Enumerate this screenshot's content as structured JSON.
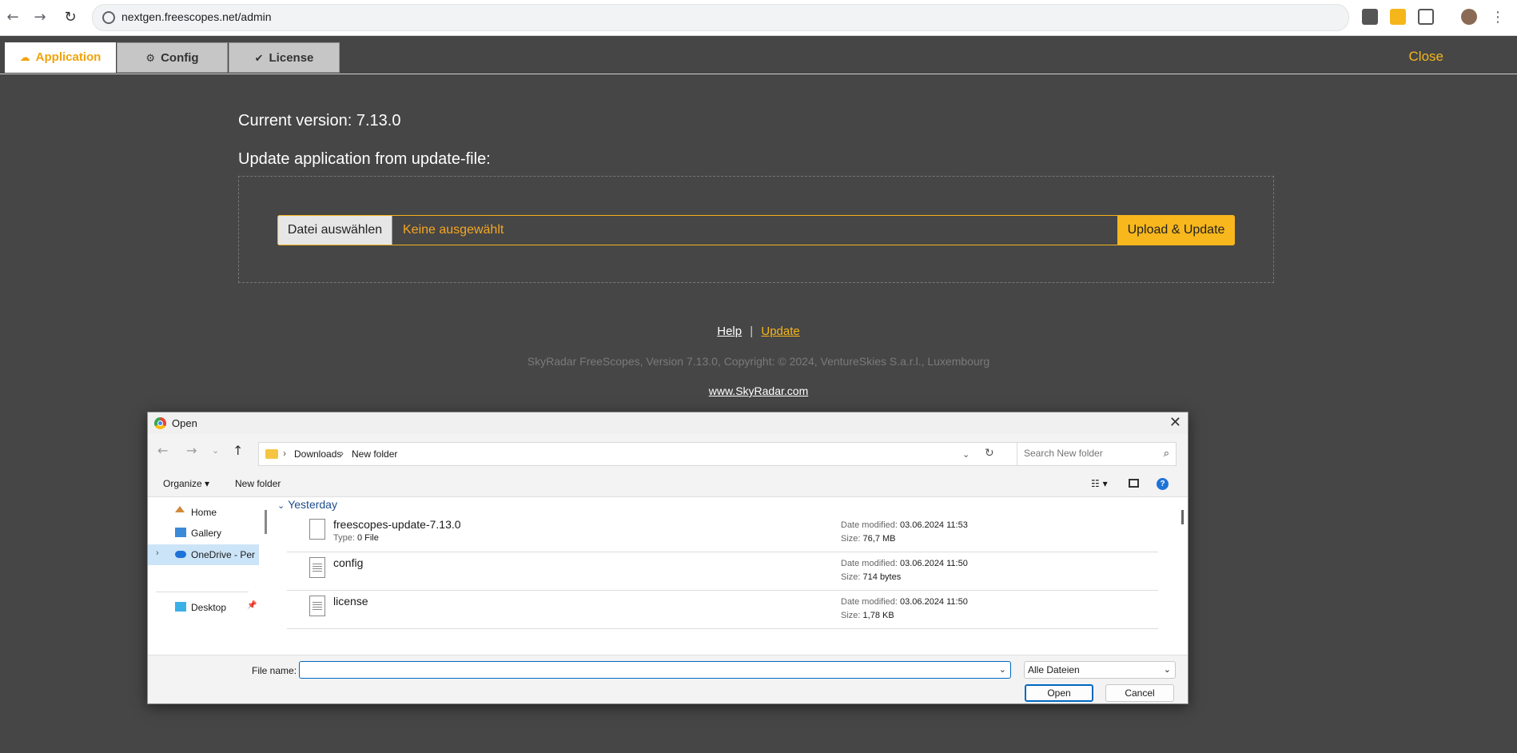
{
  "browser": {
    "url": "nextgen.freescopes.net/admin"
  },
  "tabs": [
    {
      "label": "Application",
      "icon": "cloud-upload-icon"
    },
    {
      "label": "Config",
      "icon": "gear-icon"
    },
    {
      "label": "License",
      "icon": "check-circle-icon"
    }
  ],
  "close_label": "Close",
  "main": {
    "current_version": "Current version: 7.13.0",
    "update_heading": "Update application from update-file:",
    "choose_file_label": "Datei auswählen",
    "no_file_text": "Keine ausgewählt",
    "upload_label": "Upload & Update"
  },
  "footer": {
    "help": "Help",
    "separator": "|",
    "update": "Update",
    "copyright": "SkyRadar FreeScopes, Version 7.13.0, Copyright: © 2024, VentureSkies S.a.r.l., Luxembourg",
    "website": "www.SkyRadar.com"
  },
  "dialog": {
    "title": "Open",
    "breadcrumb": [
      "Downloads",
      "New folder"
    ],
    "search_placeholder": "Search New folder",
    "organize": "Organize",
    "new_folder": "New folder",
    "nav": [
      {
        "label": "Home",
        "icon": "home-icon"
      },
      {
        "label": "Gallery",
        "icon": "gallery-icon"
      },
      {
        "label": "OneDrive - Perso",
        "icon": "onedrive-icon",
        "selected": true
      },
      {
        "label": "Desktop",
        "icon": "desktop-icon",
        "pinned": true
      }
    ],
    "group": "Yesterday",
    "files": [
      {
        "name": "freescopes-update-7.13.0",
        "type_label": "Type:",
        "type": "0 File",
        "date_label": "Date modified:",
        "date": "03.06.2024 11:53",
        "size_label": "Size:",
        "size": "76,7 MB"
      },
      {
        "name": "config",
        "date_label": "Date modified:",
        "date": "03.06.2024 11:50",
        "size_label": "Size:",
        "size": "714 bytes"
      },
      {
        "name": "license",
        "date_label": "Date modified:",
        "date": "03.06.2024 11:50",
        "size_label": "Size:",
        "size": "1,78 KB"
      }
    ],
    "file_name_label": "File name:",
    "file_name_value": "",
    "file_type": "Alle Dateien",
    "open_button": "Open",
    "cancel_button": "Cancel"
  },
  "colors": {
    "accent": "#f5b619",
    "background": "#464646",
    "dialog_focus": "#0067c0"
  }
}
